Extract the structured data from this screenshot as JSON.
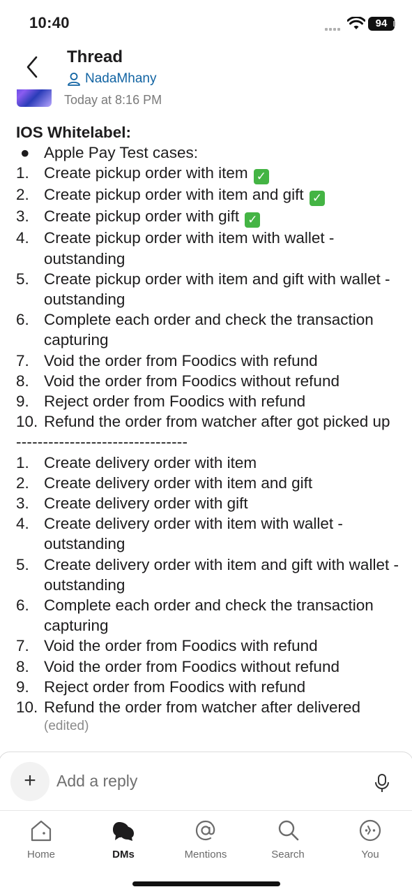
{
  "status": {
    "time": "10:40",
    "battery": "94"
  },
  "header": {
    "title": "Thread",
    "subtitle": "NadaMhany"
  },
  "message": {
    "timestamp": "Today at 8:16 PM",
    "title": "IOS Whitelabel:",
    "bullet": "Apple Pay Test cases:",
    "pickup_items": [
      {
        "num": "1.",
        "text": "Create pickup order with item",
        "check": "✓"
      },
      {
        "num": "2.",
        "text": "Create pickup order with item and gift",
        "check": "✓"
      },
      {
        "num": "3.",
        "text": "Create pickup order with gift",
        "check": "✓"
      },
      {
        "num": "4.",
        "text": "Create pickup order with item with wallet - outstanding"
      },
      {
        "num": "5.",
        "text": "Create pickup order with item and gift with wallet - outstanding"
      },
      {
        "num": "6.",
        "text": "Complete each order and check the transaction capturing"
      },
      {
        "num": "7.",
        "text": "Void the order from Foodics with refund"
      },
      {
        "num": "8.",
        "text": "Void the order from Foodics without refund"
      },
      {
        "num": "9.",
        "text": "Reject order from Foodics with refund"
      },
      {
        "num": "10.",
        "text": "Refund the order from watcher after got picked up"
      }
    ],
    "divider": "--------------------------------",
    "delivery_items": [
      {
        "num": "1.",
        "text": "Create delivery order with item"
      },
      {
        "num": "2.",
        "text": "Create delivery order with item and gift"
      },
      {
        "num": "3.",
        "text": "Create delivery order with gift"
      },
      {
        "num": "4.",
        "text": "Create delivery order with item with wallet - outstanding"
      },
      {
        "num": "5.",
        "text": "Create delivery order with item and gift with wallet - outstanding"
      },
      {
        "num": "6.",
        "text": "Complete each order and check the transaction capturing"
      },
      {
        "num": "7.",
        "text": "Void the order from Foodics with refund"
      },
      {
        "num": "8.",
        "text": "Void the order from Foodics without refund"
      },
      {
        "num": "9.",
        "text": "Reject order from Foodics with refund"
      },
      {
        "num": "10.",
        "text": "Refund the order from watcher after delivered"
      }
    ],
    "edited": "(edited)"
  },
  "composer": {
    "placeholder": "Add a reply"
  },
  "tabs": [
    {
      "label": "Home",
      "icon": "home-icon"
    },
    {
      "label": "DMs",
      "icon": "dms-icon",
      "active": true
    },
    {
      "label": "Mentions",
      "icon": "mentions-icon"
    },
    {
      "label": "Search",
      "icon": "search-icon"
    },
    {
      "label": "You",
      "icon": "you-icon"
    }
  ],
  "colors": {
    "link": "#1264a3",
    "check": "#44b444",
    "text": "#1d1c1d"
  }
}
